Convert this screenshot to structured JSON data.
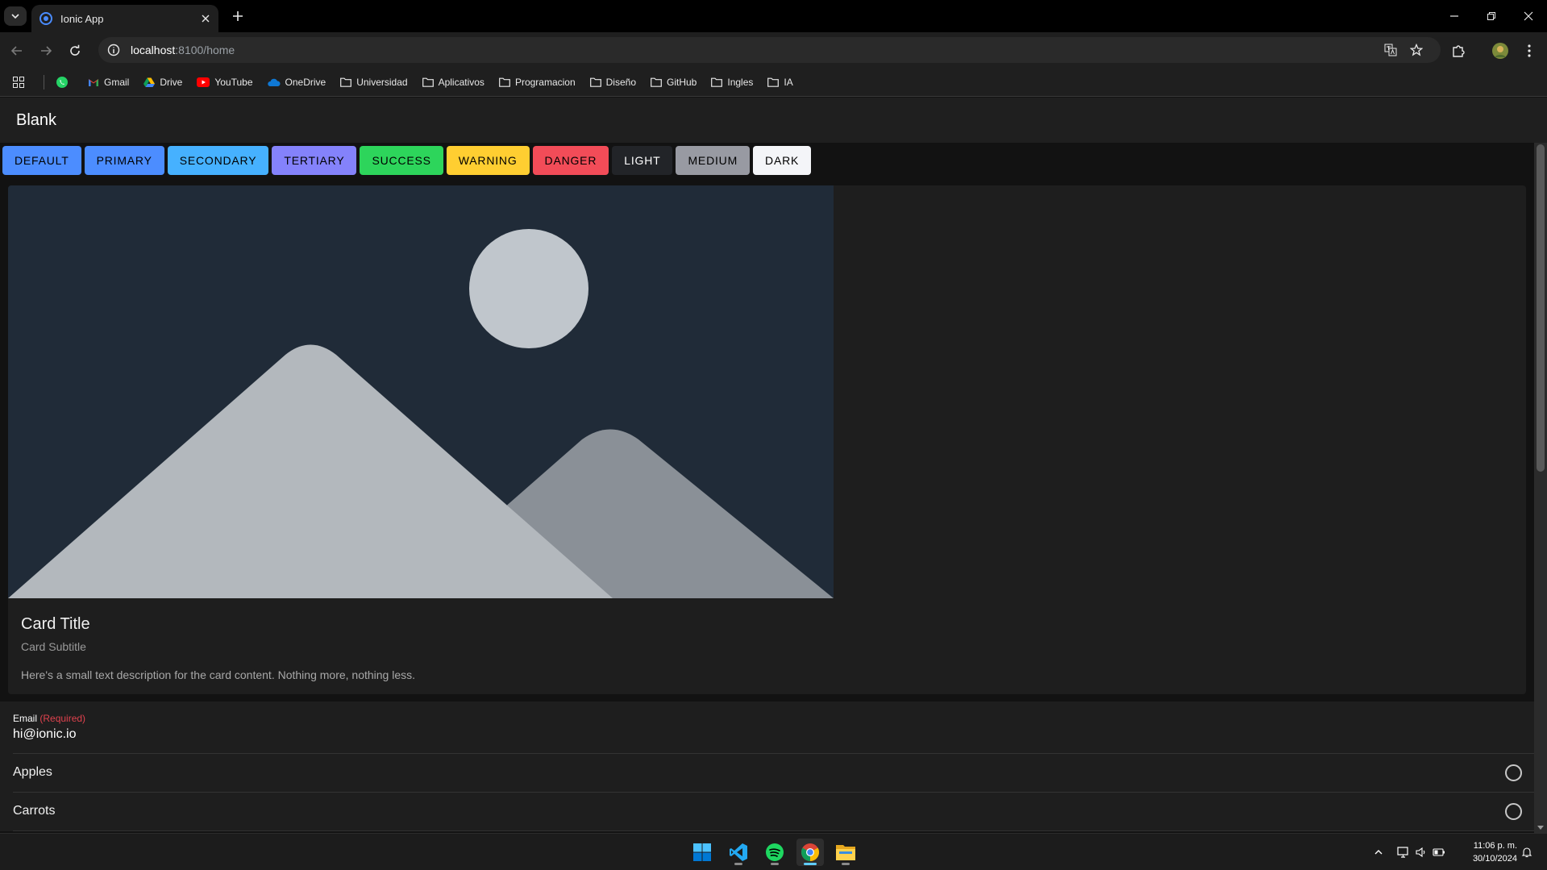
{
  "browser": {
    "tab_title": "Ionic App",
    "url_host": "localhost",
    "url_path": ":8100/home",
    "bookmarks": [
      {
        "label": "Gmail",
        "icon": "gmail-icon"
      },
      {
        "label": "Drive",
        "icon": "drive-icon"
      },
      {
        "label": "YouTube",
        "icon": "youtube-icon"
      },
      {
        "label": "OneDrive",
        "icon": "onedrive-icon"
      },
      {
        "label": "Universidad",
        "icon": "folder-icon"
      },
      {
        "label": "Aplicativos",
        "icon": "folder-icon"
      },
      {
        "label": "Programacion",
        "icon": "folder-icon"
      },
      {
        "label": "Diseño",
        "icon": "folder-icon"
      },
      {
        "label": "GitHub",
        "icon": "folder-icon"
      },
      {
        "label": "Ingles",
        "icon": "folder-icon"
      },
      {
        "label": "IA",
        "icon": "folder-icon"
      }
    ]
  },
  "app": {
    "title": "Blank",
    "buttons": [
      {
        "label": "DEFAULT",
        "bg": "#4c8dff",
        "fg": "#000000"
      },
      {
        "label": "PRIMARY",
        "bg": "#4c8dff",
        "fg": "#000000"
      },
      {
        "label": "SECONDARY",
        "bg": "#46b1ff",
        "fg": "#000000"
      },
      {
        "label": "TERTIARY",
        "bg": "#8482fb",
        "fg": "#000000"
      },
      {
        "label": "SUCCESS",
        "bg": "#2dd55b",
        "fg": "#000000"
      },
      {
        "label": "WARNING",
        "bg": "#ffce31",
        "fg": "#000000"
      },
      {
        "label": "DANGER",
        "bg": "#f24c58",
        "fg": "#000000"
      },
      {
        "label": "LIGHT",
        "bg": "#222428",
        "fg": "#ffffff"
      },
      {
        "label": "MEDIUM",
        "bg": "#989aa2",
        "fg": "#000000"
      },
      {
        "label": "DARK",
        "bg": "#f4f5f8",
        "fg": "#000000"
      }
    ],
    "card": {
      "title": "Card Title",
      "subtitle": "Card Subtitle",
      "content": "Here's a small text description for the card content. Nothing more, nothing less."
    },
    "email": {
      "label": "Email",
      "required": "(Required)",
      "value": "hi@ionic.io"
    },
    "radios": [
      "Apples",
      "Carrots"
    ]
  },
  "taskbar": {
    "apps": [
      "windows-start-icon",
      "vscode-icon",
      "spotify-icon",
      "chrome-icon",
      "file-explorer-icon"
    ],
    "time": "11:06 p. m.",
    "date": "30/10/2024"
  },
  "colors": {
    "ionic_dark_bg": "#121212",
    "item_bg": "#1e1e1e",
    "required_red": "#e0424e"
  }
}
